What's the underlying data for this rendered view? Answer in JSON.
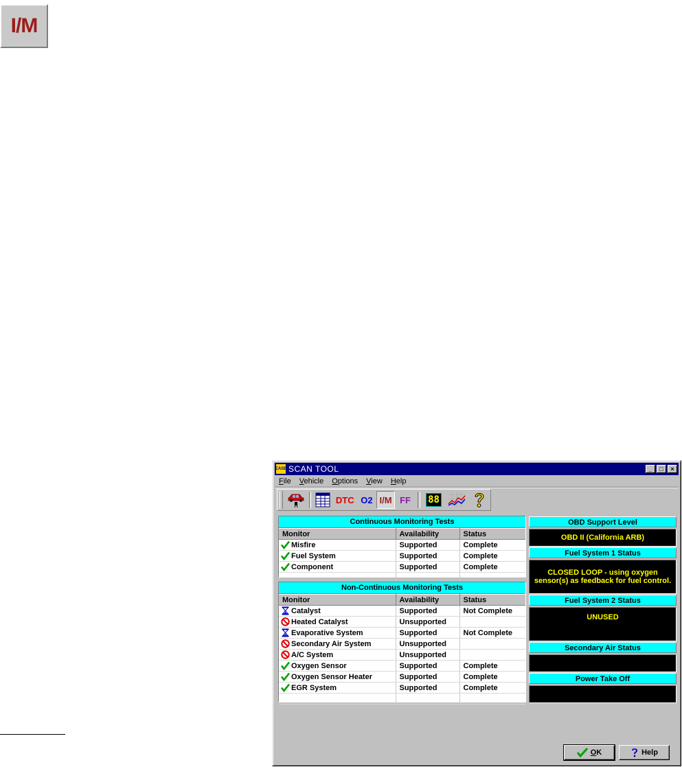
{
  "im_icon_label": "I/M",
  "window": {
    "title": "SCAN TOOL",
    "logo_text": "EASE",
    "buttons": {
      "minimize": "_",
      "maximize": "□",
      "close": "×"
    }
  },
  "menu": [
    {
      "label": "File",
      "key": "F",
      "rest": "ile"
    },
    {
      "label": "Vehicle",
      "key": "V",
      "rest": "ehicle"
    },
    {
      "label": "Options",
      "key": "O",
      "rest": "ptions"
    },
    {
      "label": "View",
      "key": "V",
      "rest": "iew"
    },
    {
      "label": "Help",
      "key": "H",
      "rest": "elp"
    }
  ],
  "toolbar": {
    "dtc": "DTC",
    "o2": "O2",
    "im": "I/M",
    "ff": "FF",
    "num": "88"
  },
  "continuous": {
    "title": "Continuous Monitoring Tests",
    "columns": [
      "Monitor",
      "Availability",
      "Status"
    ],
    "rows": [
      {
        "icon": "check-icon",
        "monitor": "Misfire",
        "availability": "Supported",
        "status": "Complete"
      },
      {
        "icon": "check-icon",
        "monitor": "Fuel System",
        "availability": "Supported",
        "status": "Complete"
      },
      {
        "icon": "check-icon",
        "monitor": "Component",
        "availability": "Supported",
        "status": "Complete"
      }
    ]
  },
  "non_continuous": {
    "title": "Non-Continuous Monitoring Tests",
    "columns": [
      "Monitor",
      "Availability",
      "Status"
    ],
    "rows": [
      {
        "icon": "hourglass-icon",
        "monitor": "Catalyst",
        "availability": "Supported",
        "status": "Not Complete"
      },
      {
        "icon": "prohibited-icon",
        "monitor": "Heated Catalyst",
        "availability": "Unsupported",
        "status": ""
      },
      {
        "icon": "hourglass-icon",
        "monitor": "Evaporative System",
        "availability": "Supported",
        "status": "Not Complete"
      },
      {
        "icon": "prohibited-icon",
        "monitor": "Secondary Air System",
        "availability": "Unsupported",
        "status": ""
      },
      {
        "icon": "prohibited-icon",
        "monitor": "A/C System",
        "availability": "Unsupported",
        "status": ""
      },
      {
        "icon": "check-icon",
        "monitor": "Oxygen Sensor",
        "availability": "Supported",
        "status": "Complete"
      },
      {
        "icon": "check-icon",
        "monitor": "Oxygen Sensor Heater",
        "availability": "Supported",
        "status": "Complete"
      },
      {
        "icon": "check-icon",
        "monitor": "EGR System",
        "availability": "Supported",
        "status": "Complete"
      }
    ]
  },
  "right": {
    "obd_support_level": {
      "label": "OBD Support Level",
      "value": "OBD II (California ARB)"
    },
    "fuel_system_1": {
      "label": "Fuel System 1 Status",
      "value": "CLOSED LOOP - using oxygen sensor(s) as feedback for fuel control."
    },
    "fuel_system_2": {
      "label": "Fuel System 2 Status",
      "value": "UNUSED"
    },
    "secondary_air": {
      "label": "Secondary Air Status",
      "value": ""
    },
    "power_take_off": {
      "label": "Power Take Off",
      "value": ""
    }
  },
  "buttons": {
    "ok": {
      "key": "O",
      "rest": "K"
    },
    "help": {
      "label": "Help"
    }
  },
  "colors": {
    "header_cyan": "#00ffff",
    "status_text_yellow": "#ffff00",
    "titlebar_navy": "#000080",
    "check_green": "#00a000",
    "prohibited_red": "#e00000",
    "hourglass_blue": "#0000c0"
  }
}
